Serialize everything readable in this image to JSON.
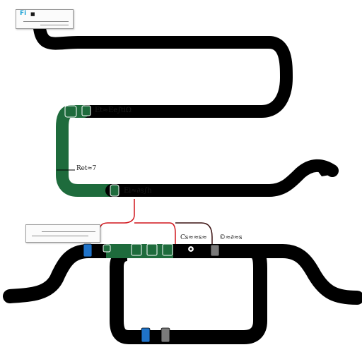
{
  "colors": {
    "track": "#000000",
    "green_route": "#1e6b3c",
    "red_connector": "#d0151b",
    "dark_connector": "#3a1010",
    "badge_blue": "#1f73c9",
    "badge_grey": "#7a7a7a",
    "badge_green": "#1e6b3c"
  },
  "top_card": {
    "title": "Fi",
    "title_suffix": "■"
  },
  "labels": {
    "station_upper": "Et≈Ee∫tiΩ",
    "station_side": "Ret≈7",
    "station_middle": "Ei≈∂s∫h",
    "station_right": "Cs≈≈s≈",
    "station_far_right": "©≈∂≈s"
  },
  "icons": {
    "pin": "location-pin-icon"
  }
}
